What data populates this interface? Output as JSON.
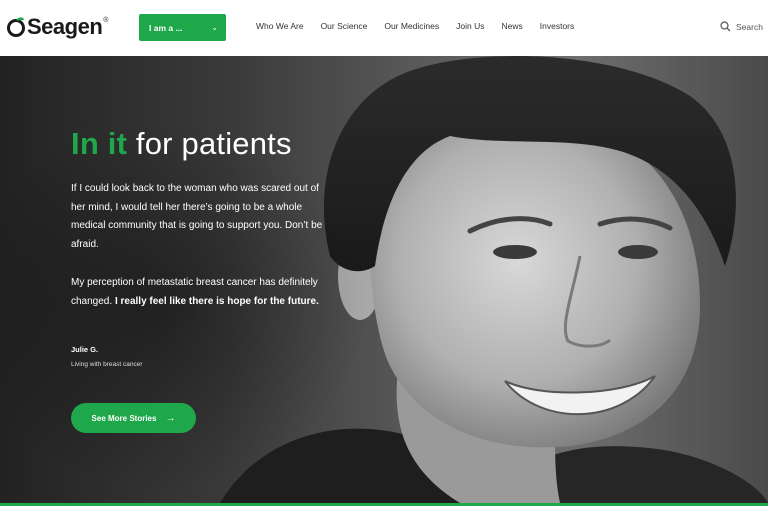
{
  "brand": {
    "logo_text": "Seagen",
    "logo_tm": "®",
    "accent": "#1fa74b"
  },
  "header": {
    "iam_label": "I am a ...",
    "nav": [
      "Who We Are",
      "Our Science",
      "Our Medicines",
      "Join Us",
      "News",
      "Investors"
    ],
    "search_label": "Search"
  },
  "hero": {
    "headline_accent": "In it",
    "headline_rest": " for patients",
    "quote_1": "If I could look back to the woman who was scared out of her mind, I would tell her there’s going to be a whole medical community that is going to support you. Don’t be afraid.",
    "quote_2_plain": "My perception of metastatic breast cancer has definitely changed. ",
    "quote_2_bold": "I really feel like there is hope for the future.",
    "author": "Julie G.",
    "author_sub": "Living with breast cancer",
    "cta_label": "See More Stories",
    "cta_arrow": "→"
  },
  "icons": {
    "search": "search-icon",
    "chevron": "chevron-down-icon",
    "arrow": "arrow-right-icon",
    "logo_mark": "seagen-logo-icon"
  }
}
